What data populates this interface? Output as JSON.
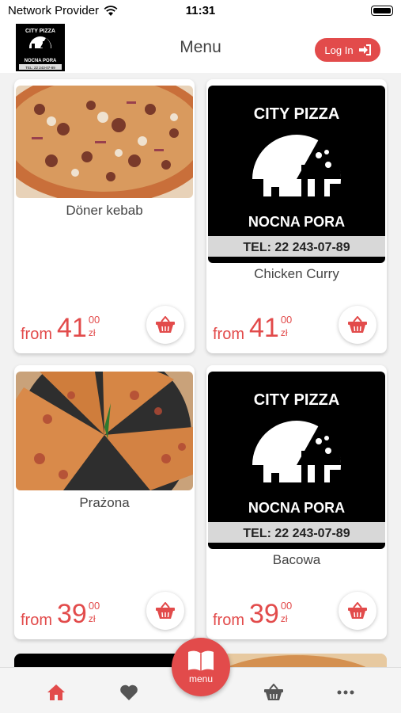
{
  "status_bar": {
    "carrier": "Network Provider",
    "time": "11:31"
  },
  "header": {
    "title": "Menu",
    "login_label": "Log In",
    "logo": {
      "line1": "CITY PIZZA",
      "line2": "NOCNA PORA",
      "phone": "TEL: 22 243-07-89"
    }
  },
  "items": [
    {
      "name": "Döner kebab",
      "from": "from",
      "price_int": "41",
      "price_dec": "00",
      "currency": "zł",
      "image": "pizza-photo-kebab"
    },
    {
      "name": "Chicken Curry",
      "from": "from",
      "price_int": "41",
      "price_dec": "00",
      "currency": "zł",
      "image": "city-pizza-logo"
    },
    {
      "name": "Prażona",
      "from": "from",
      "price_int": "39",
      "price_dec": "00",
      "currency": "zł",
      "image": "pizza-photo-prazona"
    },
    {
      "name": "Bacowa",
      "from": "from",
      "price_int": "39",
      "price_dec": "00",
      "currency": "zł",
      "image": "city-pizza-logo"
    }
  ],
  "bottom_nav": {
    "menu_label": "menu",
    "items": [
      "home-icon",
      "heart-icon",
      "basket-icon",
      "more-icon"
    ]
  },
  "colors": {
    "accent": "#e24b4b",
    "logo_bg": "#000000"
  }
}
